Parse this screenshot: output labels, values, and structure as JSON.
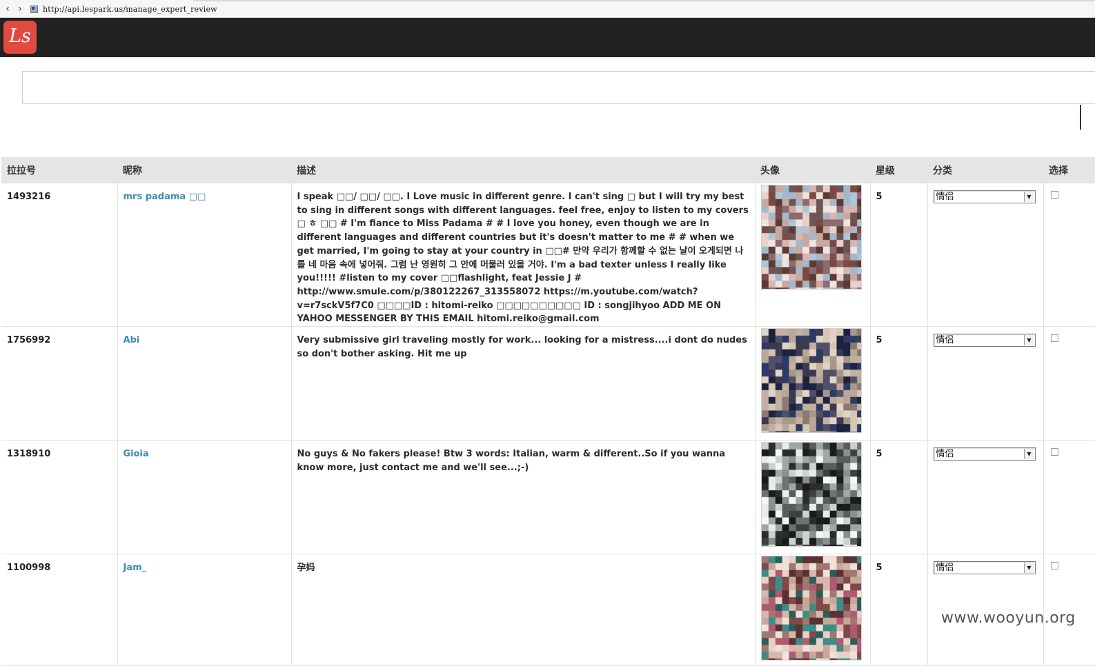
{
  "browser": {
    "url": "http://api.lespark.us/manage_expert_review",
    "back_icon": "back-arrow-icon",
    "forward_icon": "forward-arrow-icon"
  },
  "header": {
    "logo_text": "Ls",
    "bg_color": "#222222",
    "logo_color": "#e14a3e"
  },
  "search": {
    "value": "",
    "placeholder": ""
  },
  "table": {
    "headers": [
      "拉拉号",
      "昵称",
      "描述",
      "头像",
      "星级",
      "分类",
      "选择"
    ],
    "rows": [
      {
        "id": "1493216",
        "nickname": "mrs padama □□",
        "description": "I speak □□/ □□/ □□. I Love music in different genre. I can't sing □ but I will try my best to sing in different songs with different languages. feel free, enjoy to listen to my covers □ ㅎ □□ # I'm fiance to Miss Padama # # I love you honey, even though we are in different languages and different countries but it's doesn't matter to me # # when we get married, I'm going to stay at your country in □□# 만약 우리가 함께할 수 없는 날이 오게되면 나를 네 마음 속에 넣어줘. 그럼 난 영원히 그 안에 머물러 있을 거야. I'm a bad texter unless I really like you!!!!! #listen to my cover □□flashlight, feat Jessie J # http://www.smule.com/p/380122267_313558072 https://m.youtube.com/watch?v=r7sckV5f7C0 □□□□ID : hitomi-reiko □□□□□□□□□□ ID : songjihyoo ADD ME ON YAHOO MESSENGER BY THIS EMAIL hitomi.reiko@gmail.com",
        "stars": "5",
        "category": "情侣"
      },
      {
        "id": "1756992",
        "nickname": "Abi",
        "description": "Very submissive girl traveling mostly for work... looking for a mistress....i dont do nudes so don't bother asking. Hit me up",
        "stars": "5",
        "category": "情侣"
      },
      {
        "id": "1318910",
        "nickname": "Gioia",
        "description": "No guys & No fakers please! Btw 3 words: Italian, warm & different..So if you wanna know more, just contact me and we'll see...;-)",
        "stars": "5",
        "category": "情侣"
      },
      {
        "id": "1100998",
        "nickname": "Jam_",
        "description": "孕妈",
        "stars": "5",
        "category": "情侣"
      }
    ]
  },
  "avatars": [
    {
      "palette": [
        "#c9a8a0",
        "#7a4a40",
        "#e8d0cc",
        "#a3b8cc",
        "#5a3a35",
        "#d9b5b0",
        "#8c6a70",
        "#b0c4d8",
        "#f0e4e0",
        "#6e5555"
      ]
    },
    {
      "palette": [
        "#1c2240",
        "#2e3a66",
        "#c4b0a0",
        "#8a7a70",
        "#d6c6b4",
        "#3a3a50",
        "#b8a898",
        "#e0d4c6",
        "#50506a",
        "#a89888"
      ]
    },
    {
      "palette": [
        "#2a2e2a",
        "#e8ecea",
        "#6c7470",
        "#1a1c1a",
        "#a0a8a4",
        "#3e423e",
        "#ccd2ce",
        "#585e5a",
        "#f4f6f4",
        "#8a908c"
      ]
    },
    {
      "palette": [
        "#c8a89a",
        "#3a8e86",
        "#e8d2c8",
        "#5a3030",
        "#a07870",
        "#2a5e5a",
        "#d8b8ac",
        "#b05a70",
        "#804a4a",
        "#f0e2da"
      ]
    }
  ],
  "watermark": "www.wooyun.org"
}
